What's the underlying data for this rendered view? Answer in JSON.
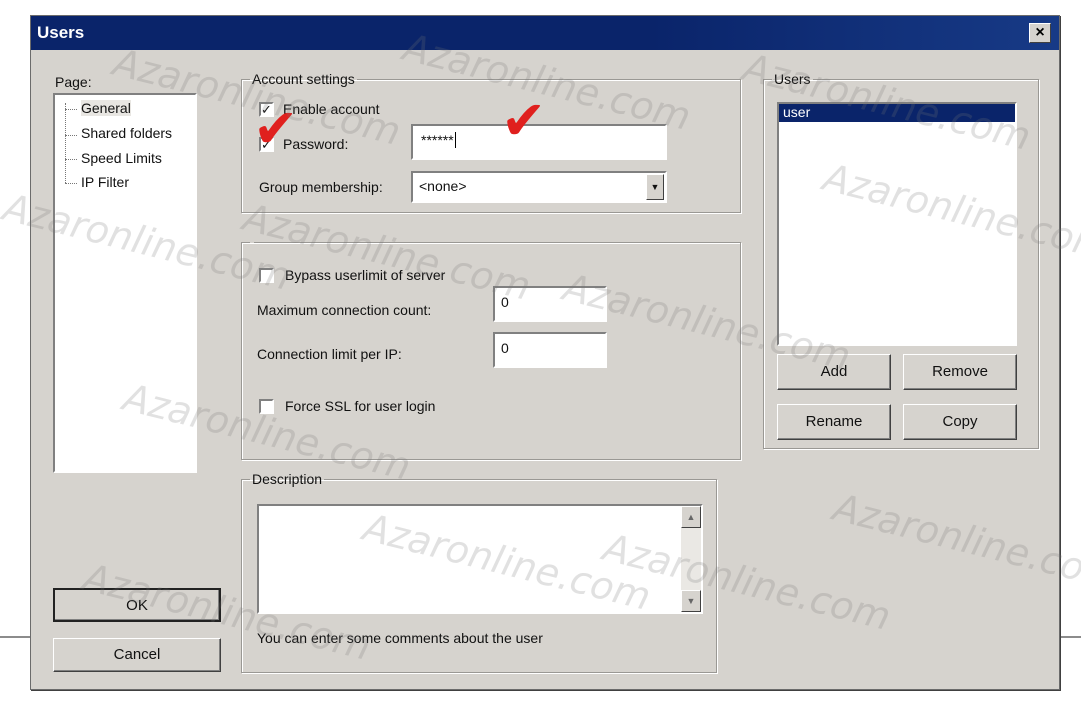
{
  "window": {
    "title": "Users",
    "close_symbol": "×"
  },
  "page_section": {
    "label": "Page:",
    "items": [
      "General",
      "Shared folders",
      "Speed Limits",
      "IP Filter"
    ],
    "selected": "General"
  },
  "account_settings": {
    "legend": "Account settings",
    "enable_account_label": "Enable account",
    "enable_account_checked": true,
    "password_label": "Password:",
    "password_checked": true,
    "password_value": "******",
    "group_membership_label": "Group membership:",
    "group_membership_value": "<none>"
  },
  "limits": {
    "bypass_label": "Bypass userlimit of server",
    "bypass_checked": false,
    "max_connection_label": "Maximum connection count:",
    "max_connection_value": "0",
    "conn_per_ip_label": "Connection limit per IP:",
    "conn_per_ip_value": "0",
    "force_ssl_label": "Force SSL for user login",
    "force_ssl_checked": false
  },
  "description": {
    "legend": "Description",
    "hint": "You can enter some comments about the user",
    "value": ""
  },
  "users": {
    "legend": "Users",
    "list": [
      "user"
    ],
    "selected": "user",
    "add_label": "Add",
    "remove_label": "Remove",
    "rename_label": "Rename",
    "copy_label": "Copy"
  },
  "dialog_buttons": {
    "ok_label": "OK",
    "cancel_label": "Cancel"
  },
  "annotations": {
    "check_mark": "✔"
  },
  "watermark": {
    "text": "Azaronline.com"
  },
  "colors": {
    "titlebar": "#0a246a",
    "selection": "#0a246a",
    "dialog_bg": "#d6d3ce",
    "annotation": "#e0201e"
  },
  "icons": [
    "close-icon",
    "checkbox-check-icon",
    "dropdown-arrow-icon",
    "scroll-up-icon",
    "scroll-down-icon",
    "red-checkmark-icon"
  ]
}
